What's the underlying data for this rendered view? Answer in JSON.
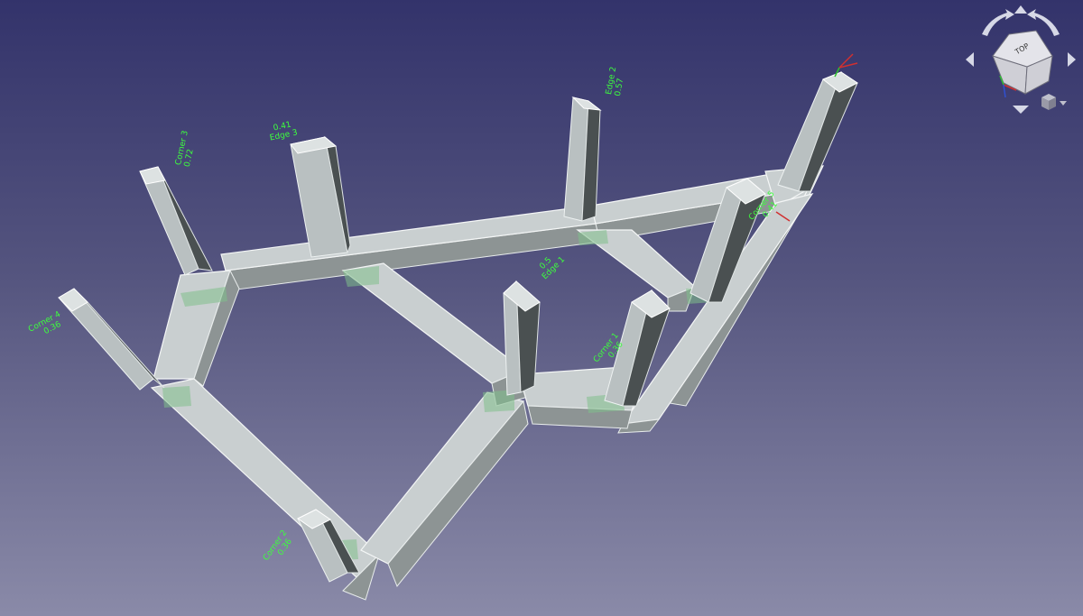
{
  "navigation_cube": {
    "face_label": "TOP"
  },
  "annotations": [
    {
      "id": "corner-4",
      "lines": [
        "Corner 4",
        "0.36"
      ]
    },
    {
      "id": "corner-3",
      "lines": [
        "Corner 3",
        "0.72"
      ]
    },
    {
      "id": "edge-3",
      "lines": [
        "0.41",
        "Edge 3"
      ]
    },
    {
      "id": "edge-2",
      "lines": [
        "Edge 2",
        "0.57"
      ]
    },
    {
      "id": "edge-mid",
      "lines": [
        "0.5",
        "Edge 1"
      ]
    },
    {
      "id": "corner-1",
      "lines": [
        "Corner 1",
        "0.36"
      ]
    },
    {
      "id": "corner-5",
      "lines": [
        "Corner 5",
        "0.41"
      ]
    },
    {
      "id": "corner-2",
      "lines": [
        "Corner 2",
        "0.36"
      ]
    }
  ],
  "colors": {
    "background_top": "#33336b",
    "background_bottom": "#8a8aa8",
    "annotation": "#3dff3d",
    "axis_x": "#d03030",
    "axis_y": "#30c030",
    "axis_z": "#3050d0"
  }
}
